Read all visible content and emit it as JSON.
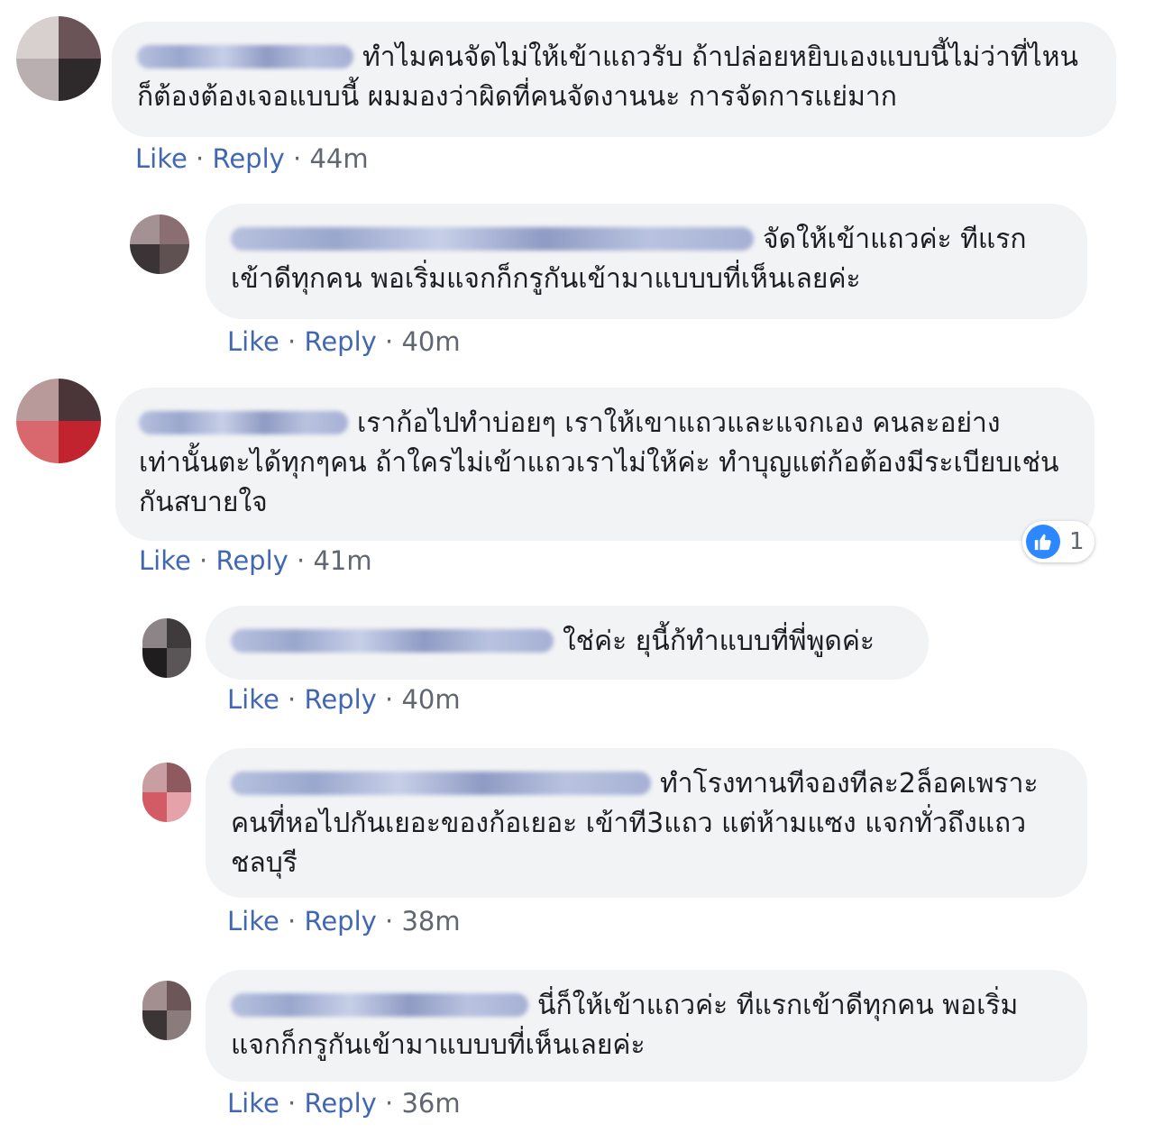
{
  "colors": {
    "link": "#4267b2",
    "meta": "#606770",
    "bubble": "#f2f3f5",
    "like_icon": "#2d88ff"
  },
  "actions_template": {
    "like": "Like",
    "reply": "Reply",
    "separator": "·"
  },
  "comments": [
    {
      "text": "ทำไมคนจัดไม่ให้เข้าแถวรับ ถ้าปล่อยหยิบเองแบบนี้ไม่ว่าที่ไหนก็ต้องต้องเจอแบบนี้ ผมมองว่าผิดที่คนจัดงานนะ การจัดการแย่มาก",
      "time": "44m"
    },
    {
      "text": "จัดให้เข้าแถวค่ะ ทีแรกเข้าดีทุกคน พอเริ่มแจกก็กรูกันเข้ามาแบบบที่เห็นเลยค่ะ",
      "time": "40m"
    },
    {
      "text": "เราก้อไปทำบ่อยๆ เราให้เขาแถวและแจกเอง คนละอย่างเท่านั้นตะได้ทุกๆคน ถ้าใครไม่เข้าแถวเราไม่ให้ค่ะ ทำบุญแต่ก้อต้องมีระเบียบเช่นกันสบายใจ",
      "time": "41m",
      "reaction": {
        "icon": "like-icon",
        "count": "1"
      }
    },
    {
      "text": "ใช่ค่ะ ยุนี้ก้ทำแบบที่พี่พูดค่ะ",
      "time": "40m"
    },
    {
      "text": "ทำโรงทานทีจองทีละ2ล็อคเพราะคนที่หอไปกันเยอะของก้อเยอะ เข้าที3แถว แต่ห้ามแซง แจกทั่วถึงแถวชลบุรี",
      "time": "38m"
    },
    {
      "text": "นี่ก็ให้เข้าแถวค่ะ ทีแรกเข้าดีทุกคน พอเริ่มแจกก็กรูกันเข้ามาแบบบที่เห็นเลยค่ะ",
      "time": "36m"
    }
  ]
}
